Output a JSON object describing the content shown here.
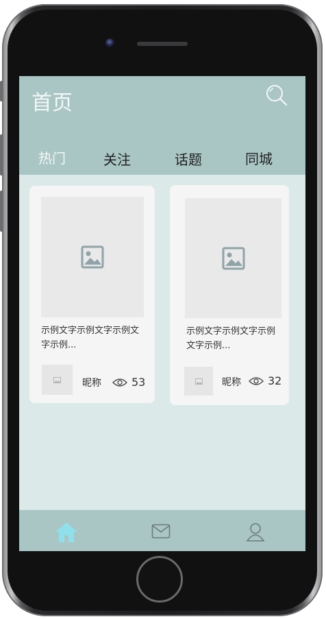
{
  "header": {
    "title": "首页",
    "search_icon": "search-icon"
  },
  "tabs": [
    {
      "label": "热门",
      "active": true
    },
    {
      "label": "关注",
      "active": false
    },
    {
      "label": "话题",
      "active": false
    },
    {
      "label": "同城",
      "active": false
    }
  ],
  "cards": [
    {
      "text": "示例文字示例文字示例文字示例...",
      "nickname": "昵称",
      "views": "53",
      "image_icon": "image-placeholder-icon"
    },
    {
      "text": "示例文字示例文字示例文字示例...",
      "nickname": "昵称",
      "views": "32",
      "image_icon": "image-placeholder-icon"
    }
  ],
  "bottom_nav": [
    {
      "icon": "home-icon",
      "active": true
    },
    {
      "icon": "mail-icon",
      "active": false
    },
    {
      "icon": "user-icon",
      "active": false
    }
  ],
  "colors": {
    "header_bg": "#a9c6c5",
    "content_bg": "#dbeae8",
    "card_bg": "#f5f5f5",
    "active_home": "#8fe0ea"
  }
}
